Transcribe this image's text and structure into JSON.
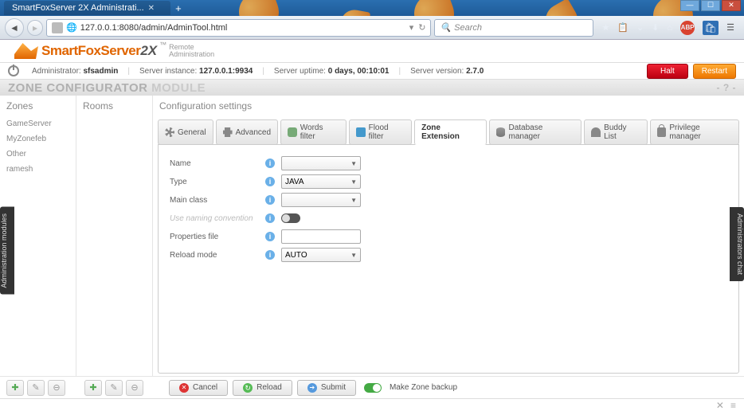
{
  "browser": {
    "tab_title": "SmartFoxServer 2X Administrati...",
    "url": "127.0.0.1:8080/admin/AdminTool.html",
    "search_placeholder": "Search"
  },
  "logo": {
    "brand": "SmartFoxServer",
    "suffix": "2X",
    "tm": "™",
    "sub1": "Remote",
    "sub2": "Administration"
  },
  "status": {
    "admin_label": "Administrator:",
    "admin_value": "sfsadmin",
    "instance_label": "Server instance:",
    "instance_value": "127.0.0.1:9934",
    "uptime_label": "Server uptime:",
    "uptime_value": "0 days, 00:10:01",
    "version_label": "Server version:",
    "version_value": "2.7.0",
    "halt": "Halt",
    "restart": "Restart"
  },
  "module": {
    "title1": "ZONE CONFIGURATOR",
    "title2": "MODULE",
    "help": "- ? -"
  },
  "columns": {
    "zones": "Zones",
    "rooms": "Rooms",
    "config": "Configuration settings"
  },
  "zones": [
    "GameServer",
    "MyZonefeb",
    "Other",
    "ramesh"
  ],
  "tabs": {
    "general": "General",
    "advanced": "Advanced",
    "words": "Words filter",
    "flood": "Flood filter",
    "extension": "Zone Extension",
    "db": "Database manager",
    "buddy": "Buddy List",
    "privilege": "Privilege manager"
  },
  "form": {
    "name_label": "Name",
    "name_value": "",
    "type_label": "Type",
    "type_value": "JAVA",
    "main_label": "Main class",
    "main_value": "",
    "naming_label": "Use naming convention",
    "props_label": "Properties file",
    "props_value": "",
    "reload_label": "Reload mode",
    "reload_value": "AUTO"
  },
  "actions": {
    "cancel": "Cancel",
    "reload": "Reload",
    "submit": "Submit",
    "backup": "Make Zone backup"
  },
  "sidetabs": {
    "left": "Administration modules",
    "right": "Administrators chat"
  }
}
